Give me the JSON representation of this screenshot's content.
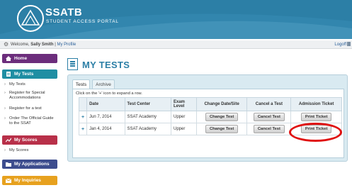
{
  "header": {
    "brand": "SSATB",
    "subtitle": "STUDENT ACCESS PORTAL",
    "bg_color": "#2c7fa6"
  },
  "welcome_bar": {
    "welcome_prefix": "Welcome, ",
    "user_name": "Sally Smith",
    "separator": " | ",
    "profile_link": "My Profile",
    "logoff": "Logoff"
  },
  "sidebar": {
    "home": "Home",
    "tests": {
      "label": "My Tests",
      "links": [
        "My Tests",
        "Register for Special Accommodations",
        "Register for a test",
        "Order The Official Guide to the SSAT"
      ]
    },
    "scores": {
      "label": "My Scores",
      "links": [
        "My Scores"
      ]
    },
    "applications": "My Applications",
    "inquiries": "My Inquiries",
    "colors": {
      "home": "#6c2d7c",
      "tests": "#1f8ea3",
      "scores": "#b83049",
      "applications": "#3d4d8e",
      "inquiries": "#e7a11e"
    }
  },
  "main": {
    "title": "MY TESTS",
    "tabs": [
      "Tests",
      "Archive"
    ],
    "active_tab": "Tests",
    "hint": "Click on the '+' icon to expand a row.",
    "table": {
      "headers": [
        "Date",
        "Test Center",
        "Exam Level",
        "Change Date/Site",
        "Cancel a Test",
        "Admission Ticket"
      ],
      "rows": [
        {
          "expand": "+",
          "date": "Jun 7, 2014",
          "center": "SSAT Academy",
          "level": "Upper",
          "change": "Change Test",
          "cancel": "Cancel Test",
          "ticket": "Print Ticket"
        },
        {
          "expand": "+",
          "date": "Jan 4, 2014",
          "center": "SSAT Academy",
          "level": "Upper",
          "change": "Change Test",
          "cancel": "Cancel Test",
          "ticket": "Print Ticket"
        }
      ]
    },
    "highlight_color": "#e01010"
  }
}
